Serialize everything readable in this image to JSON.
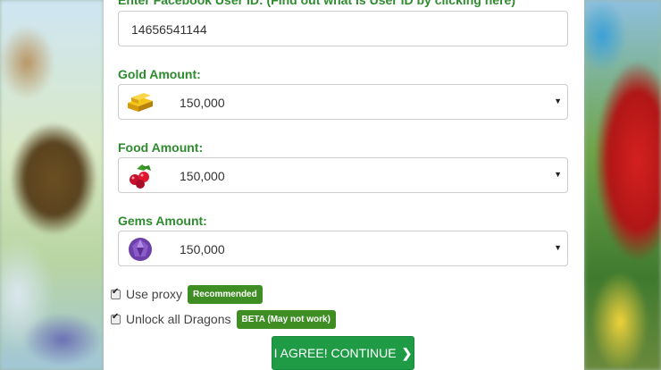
{
  "form": {
    "user_id_label": "Enter Facebook User ID: (Find out what is User ID by clicking here)",
    "user_id_value": "14656541144",
    "gold": {
      "label": "Gold Amount:",
      "value": "150,000",
      "icon": "gold-bars-icon"
    },
    "food": {
      "label": "Food Amount:",
      "value": "150,000",
      "icon": "berries-icon"
    },
    "gems": {
      "label": "Gems Amount:",
      "value": "150,000",
      "icon": "gem-icon"
    },
    "use_proxy": {
      "label": "Use proxy",
      "badge": "Recommended",
      "checked": true
    },
    "unlock_dragons": {
      "label": "Unlock all Dragons",
      "badge": "BETA (May not work)",
      "checked": true
    },
    "submit_label": "I AGREE! CONTINUE"
  },
  "colors": {
    "label_green": "#2e8b2e",
    "badge_green": "#3e8e24",
    "button_green": "#1f9b45"
  }
}
